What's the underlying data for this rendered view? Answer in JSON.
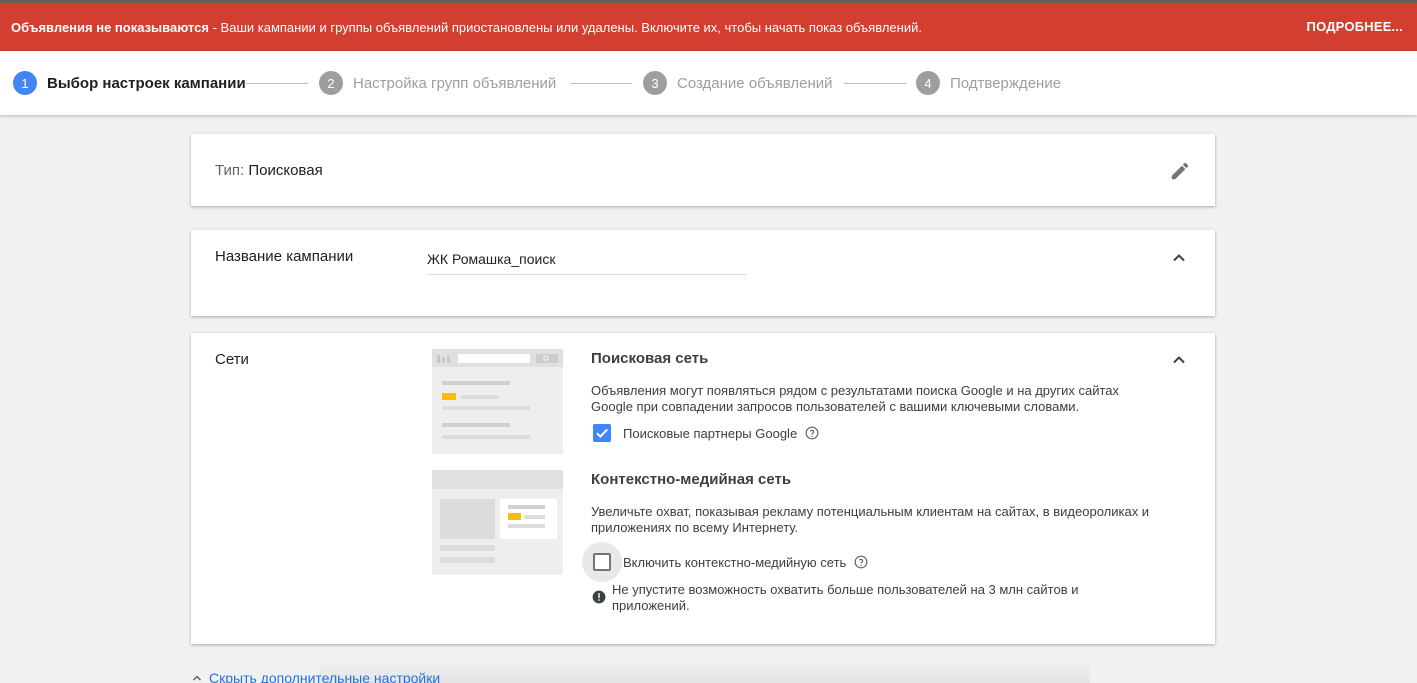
{
  "banner": {
    "bold": "Объявления не показываются",
    "message": " - Ваши кампании и группы объявлений приостановлены или удалены. Включите их, чтобы начать показ объявлений.",
    "more": "ПОДРОБНЕЕ..."
  },
  "steps": [
    {
      "num": "1",
      "label": "Выбор настроек кампании",
      "active": true
    },
    {
      "num": "2",
      "label": "Настройка групп объявлений",
      "active": false
    },
    {
      "num": "3",
      "label": "Создание объявлений",
      "active": false
    },
    {
      "num": "4",
      "label": "Подтверждение",
      "active": false
    }
  ],
  "type_card": {
    "label": "Тип:",
    "value": "Поисковая"
  },
  "name_card": {
    "title": "Название кампании",
    "value": "ЖК Ромашка_поиск"
  },
  "networks_card": {
    "title": "Сети",
    "search": {
      "title": "Поисковая сеть",
      "description": "Объявления могут появляться рядом с результатами поиска Google и на других сайтах Google при совпадении запросов пользователей с вашими ключевыми словами.",
      "checkbox_label": "Поисковые партнеры Google",
      "checked": true
    },
    "display": {
      "title": "Контекстно-медийная сеть",
      "description": "Увеличьте охват, показывая рекламу потенциальным клиентам на сайтах, в видеороликах и приложениях по всему Интернету.",
      "checkbox_label": "Включить контекстно-медийную сеть",
      "checked": false,
      "warning": "Не упустите возможность охватить больше пользователей на 3 млн сайтов и приложений."
    }
  },
  "more_settings_link": "Скрыть дополнительные настройки",
  "colors": {
    "banner": "#d23f31",
    "accent": "#4285f4",
    "link": "#1a73e8",
    "illustration_highlight": "#fbbc04"
  }
}
